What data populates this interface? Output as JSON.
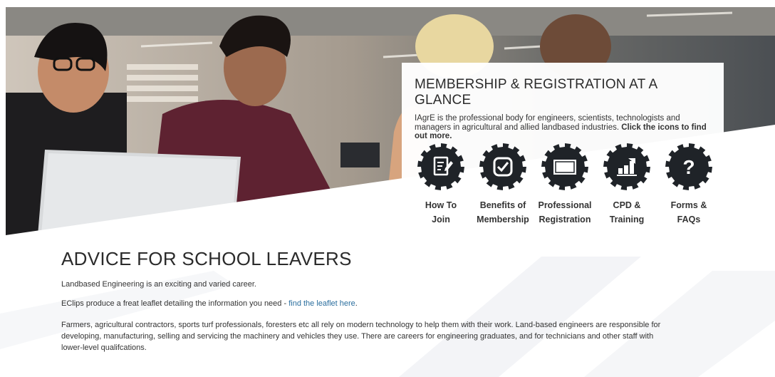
{
  "glance": {
    "title": "MEMBERSHIP & REGISTRATION AT A GLANCE",
    "intro_text": "IAgrE is the professional body for engineers, scientists, technologists and managers in agricultural and allied landbased industries. ",
    "intro_bold": "Click the icons to find out more.",
    "items": [
      {
        "label": "How To\nJoin",
        "icon": "form-edit-icon"
      },
      {
        "label": "Benefits of\nMembership",
        "icon": "checkbox-icon"
      },
      {
        "label": "Professional\nRegistration",
        "icon": "id-card-icon"
      },
      {
        "label": "CPD &\nTraining",
        "icon": "bar-chart-icon"
      },
      {
        "label": "Forms &\nFAQs",
        "icon": "question-mark-icon"
      }
    ]
  },
  "advice": {
    "title": "ADVICE FOR SCHOOL LEAVERS",
    "p1": "Landbased Engineering is an exciting and varied career.",
    "p2_text": "EClips produce a freat leaflet detailing the information you need - ",
    "p2_link": "find the leaflet here",
    "p2_end": ".",
    "p3": "Farmers, agricultural contractors, sports turf professionals, foresters etc all rely on modern technology to help them with their work. Land-based engineers are responsible for developing, manufacturing, selling and servicing the machinery and vehicles they use. There are careers for engineering graduates, and for technicians and other staff with lower-level qualifcations."
  },
  "colors": {
    "gear_fill": "#1f2328",
    "link": "#2a6e9e",
    "heading": "#2b2b2b"
  }
}
